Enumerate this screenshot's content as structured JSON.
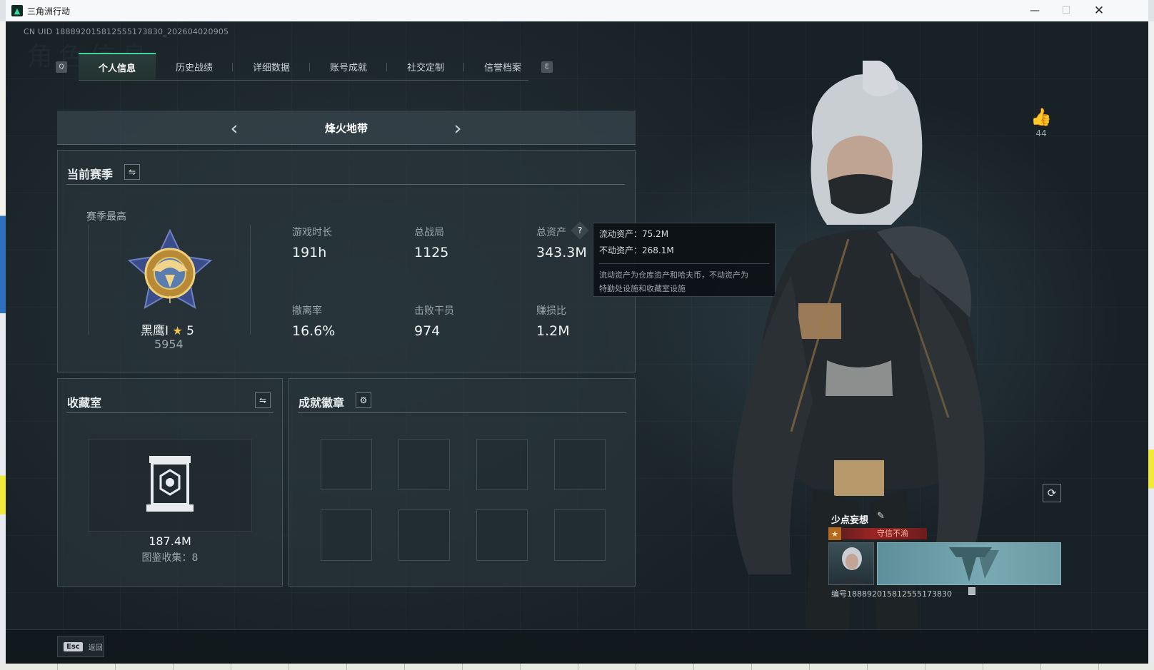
{
  "window": {
    "title": "三角洲行动",
    "app_icon": "delta-logo-icon"
  },
  "uid_line": "CN UID 188892015812555173830_202604020905",
  "background_heading": "角色信息",
  "tabs": {
    "left_key": "Q",
    "right_key": "E",
    "items": [
      {
        "label": "个人信息",
        "active": true
      },
      {
        "label": "历史战绩",
        "active": false
      },
      {
        "label": "详细数据",
        "active": false
      },
      {
        "label": "账号成就",
        "active": false
      },
      {
        "label": "社交定制",
        "active": false
      },
      {
        "label": "信誉档案",
        "active": false
      }
    ]
  },
  "mode": {
    "title": "烽火地带"
  },
  "season": {
    "title": "当前赛季",
    "best_label": "赛季最高",
    "rank_name": "黑鹰I",
    "rank_stars": "5",
    "rank_score": "5954",
    "stats": [
      {
        "label": "游戏时长",
        "value": "191h"
      },
      {
        "label": "总战局",
        "value": "1125"
      },
      {
        "label": "总资产",
        "value": "343.3M"
      },
      {
        "label": "撤离率",
        "value": "16.6%"
      },
      {
        "label": "击败干员",
        "value": "974"
      },
      {
        "label": "赚损比",
        "value": "1.2M"
      }
    ]
  },
  "tooltip": {
    "liquid": "流动资产：75.2M",
    "fixed": "不动资产：268.1M",
    "desc_line1": "流动资产为仓库资产和哈夫币，不动资产为",
    "desc_line2": "特勤处设施和收藏室设施"
  },
  "collection": {
    "title": "收藏室",
    "value": "187.4M",
    "count_label": "图鉴收集：8"
  },
  "achievements": {
    "title": "成就徽章",
    "slots": 8
  },
  "like": {
    "count": "44"
  },
  "player_card": {
    "name": "少点妄想",
    "rank_tag": "守信不渝",
    "id_line": "编号188892015812555173830"
  },
  "bottom": {
    "esc_key": "Esc",
    "back_label": "返回"
  },
  "colors": {
    "accent": "#3fd79b",
    "panel_border": "#47545a",
    "bg": "#1a2226"
  }
}
